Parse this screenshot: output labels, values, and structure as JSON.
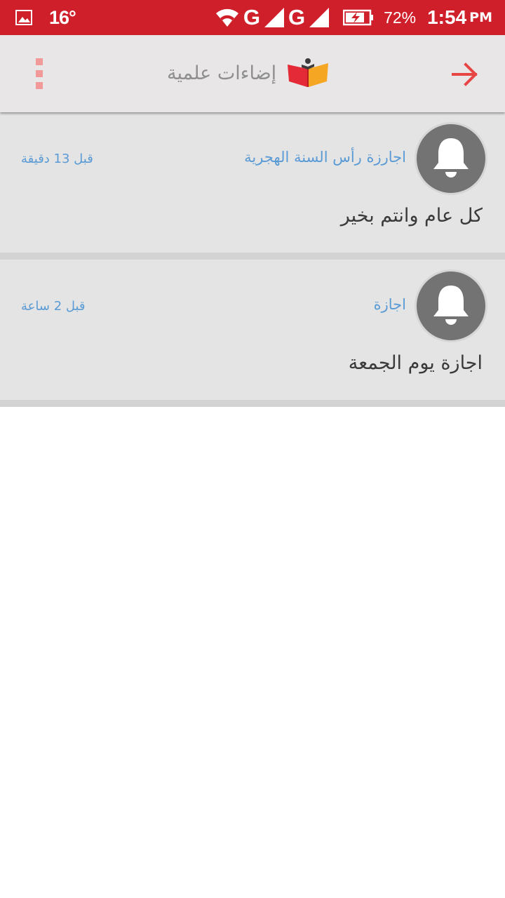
{
  "status_bar": {
    "temperature": "16°",
    "network_1": "G",
    "network_2": "G",
    "battery_percent": "72%",
    "time": "1:54",
    "ampm": "PM"
  },
  "app_bar": {
    "title": "إضاءات علمية",
    "logo_icon": "open-book-icon",
    "menu_icon": "overflow-menu-icon",
    "back_icon": "arrow-right-icon"
  },
  "colors": {
    "status_bar": "#cf1f2a",
    "accent": "#e84545",
    "title_blue": "#5b9bd5"
  },
  "notifications": [
    {
      "title": "اجارزة رأس السنة الهجرية",
      "time": "قبل 13 دقيقة",
      "body": "كل عام وانتم بخير",
      "icon": "bell-icon"
    },
    {
      "title": "اجازة",
      "time": "قبل 2 ساعة",
      "body": "اجازة يوم الجمعة",
      "icon": "bell-icon"
    }
  ]
}
